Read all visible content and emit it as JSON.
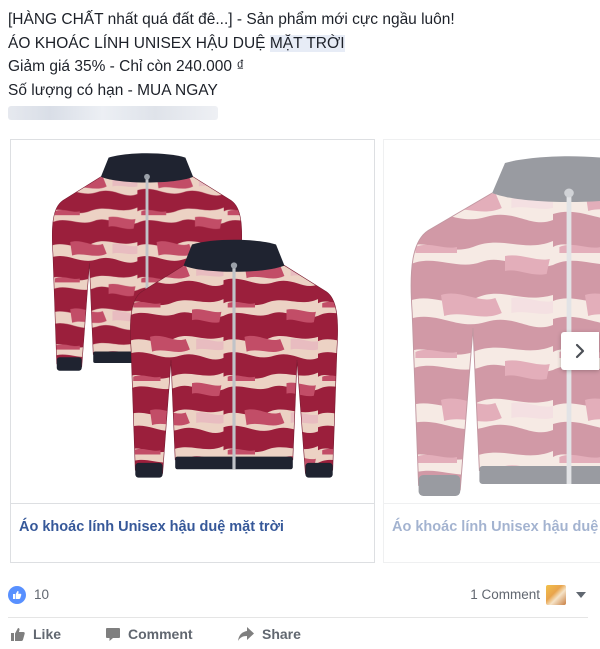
{
  "post": {
    "lines": [
      "[HÀNG CHẤT nhất quá đất đê...] - Sản phẩm mới cực ngầu luôn!",
      "ÁO KHOÁC LÍNH UNISEX HẬU DUỆ",
      "MẶT TRỜI",
      "Giảm giá 35% - Chỉ còn 240.000 ₫",
      "Số lượng có hạn - MUA NGAY"
    ]
  },
  "carousel": {
    "cards": [
      {
        "caption": "Áo khoác lính Unisex hậu duệ mặt trời"
      },
      {
        "caption": "Áo khoác lính Unisex hậu duệ mặt trời"
      }
    ],
    "next_icon": "chevron-right-icon"
  },
  "stats": {
    "like_count": "10",
    "comment_count": "1 Comment"
  },
  "actions": {
    "like": "Like",
    "comment": "Comment",
    "share": "Share"
  },
  "colors": {
    "link": "#365899",
    "like_badge": "#5890ff",
    "jacket_dark": "#9b1f3c",
    "jacket_light": "#ecd4c2",
    "collar": "#1f2330"
  }
}
